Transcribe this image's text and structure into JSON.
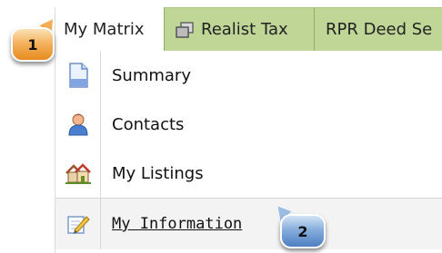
{
  "tabs": [
    {
      "label": "My Matrix",
      "state": "active"
    },
    {
      "label": "Realist Tax",
      "icon": "window-copy-icon"
    },
    {
      "label": "RPR Deed Se",
      "icon": ""
    }
  ],
  "menu": {
    "items": [
      {
        "label": "Summary",
        "icon": "document-icon"
      },
      {
        "label": "Contacts",
        "icon": "person-icon"
      },
      {
        "label": "My Listings",
        "icon": "houses-icon"
      },
      {
        "label": "My Information",
        "icon": "edit-pencil-icon",
        "state": "hovered"
      }
    ]
  },
  "callouts": [
    {
      "number": "1",
      "color": "#ef9a34"
    },
    {
      "number": "2",
      "color": "#5e8fcb"
    }
  ],
  "colors": {
    "tab_inactive_bg": "#bfd697",
    "hover_row_bg": "#f3f3f3"
  }
}
